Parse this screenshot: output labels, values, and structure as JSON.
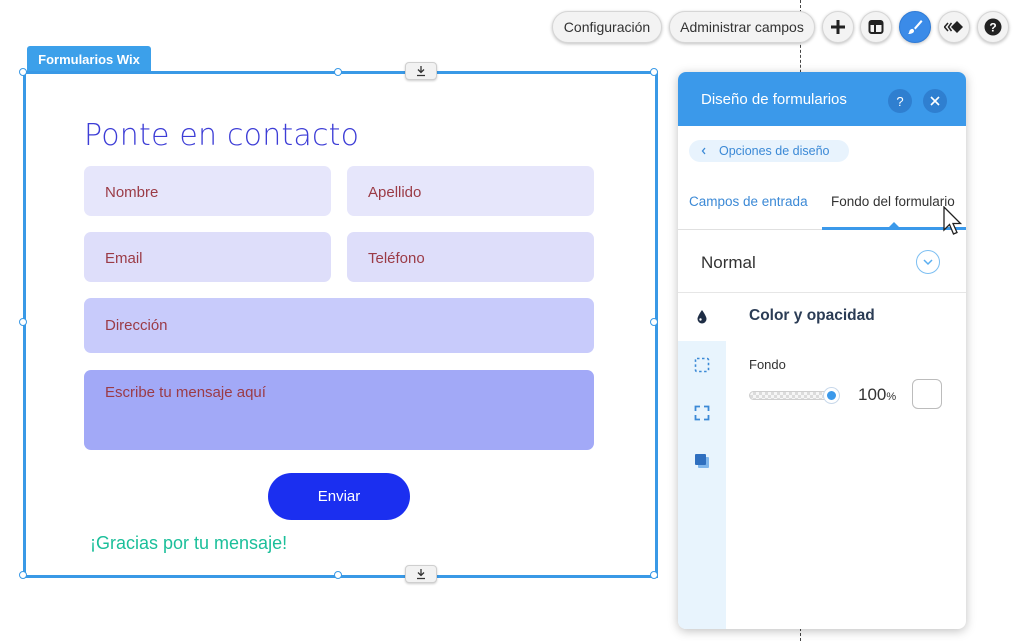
{
  "toolbar": {
    "config_label": "Configuración",
    "manage_fields_label": "Administrar campos",
    "help_label": "?"
  },
  "widget": {
    "tag": "Formularios Wix"
  },
  "form": {
    "title": "Ponte en contacto",
    "fields": {
      "name": "Nombre",
      "lastname": "Apellido",
      "email": "Email",
      "phone": "Teléfono",
      "address": "Dirección",
      "message": "Escribe tu mensaje aquí"
    },
    "send_label": "Enviar",
    "thanks": "¡Gracias por tu mensaje!"
  },
  "panel": {
    "title": "Diseño de formularios",
    "help": "?",
    "breadcrumb": "Opciones de diseño",
    "tabs": [
      {
        "label": "Campos de entrada"
      },
      {
        "label": "Fondo del formulario"
      }
    ],
    "state_select": "Normal",
    "section_title": "Color y opacidad",
    "fondo_label": "Fondo",
    "opacity_value": "100",
    "opacity_unit": "%",
    "opacity_fraction": 1.0
  },
  "colors": {
    "accent": "#3b99ea",
    "send_button": "#1b2ff0",
    "title": "#3d3dd6",
    "thanks": "#1bbf9a",
    "field_text": "#9b3b46"
  }
}
